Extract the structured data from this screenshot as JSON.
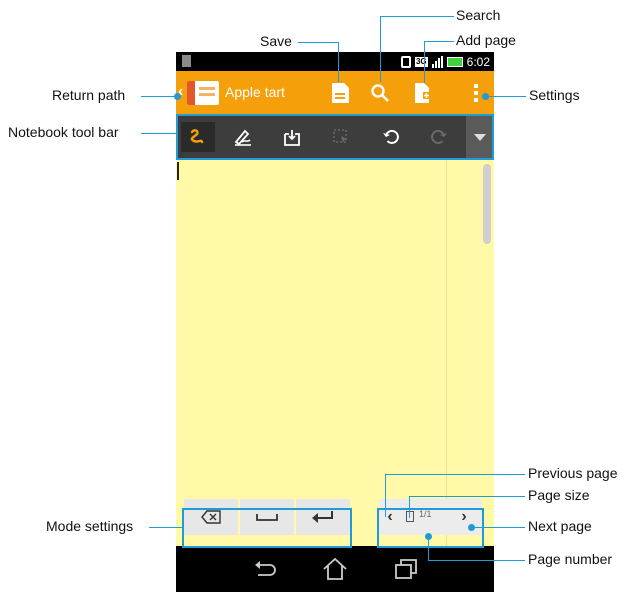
{
  "status_bar": {
    "time": "6:02",
    "network": "3G"
  },
  "action_bar": {
    "title": "Apple tart",
    "back_glyph": "‹"
  },
  "pager": {
    "page_number": "1/1",
    "prev_glyph": "‹",
    "next_glyph": "›"
  },
  "callouts": {
    "save": "Save",
    "search": "Search",
    "add_page": "Add page",
    "return_path": "Return path",
    "settings": "Settings",
    "notebook_toolbar": "Notebook tool bar",
    "previous_page": "Previous page",
    "page_size": "Page size",
    "mode_settings": "Mode settings",
    "next_page": "Next page",
    "page_number": "Page number"
  },
  "colors": {
    "accent": "#f5a00a",
    "callout": "#1f9bd7",
    "toolbar": "#3d3d3d",
    "page": "#fff9a8",
    "pen_active": "#f5a00a"
  },
  "icons": {
    "save": "save-icon",
    "search": "search-icon",
    "add_page": "add-page-icon",
    "settings": "overflow-menu-icon",
    "pen": "pen-icon",
    "highlighter": "highlighter-icon",
    "insert": "insert-icon",
    "select": "select-icon",
    "undo": "undo-icon",
    "redo": "redo-icon",
    "backspace": "backspace-icon",
    "space": "space-icon",
    "enter": "enter-icon",
    "back": "back-icon",
    "home": "home-icon",
    "recent": "recent-apps-icon"
  }
}
